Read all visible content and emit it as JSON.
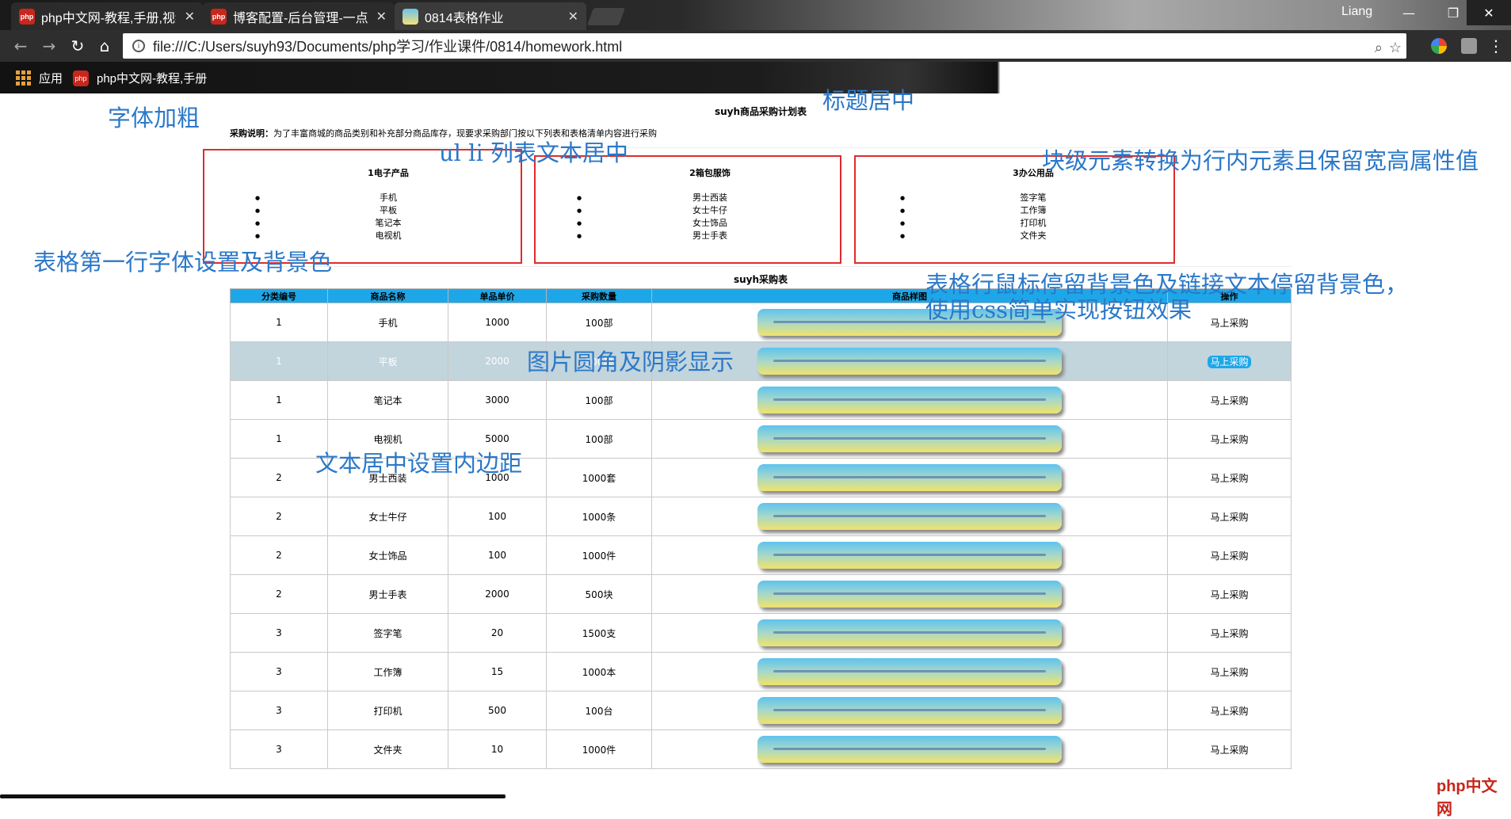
{
  "browser": {
    "tabs": [
      {
        "title": "php中文网-教程,手册,视频"
      },
      {
        "title": "博客配置-后台管理-一点"
      },
      {
        "title": "0814表格作业"
      }
    ],
    "user": "Liang",
    "url": "file:///C:/Users/suyh93/Documents/php学习/作业课件/0814/homework.html",
    "bookmarks": {
      "apps": "应用",
      "php": "php中文网-教程,手册"
    }
  },
  "page": {
    "title": "suyh商品采购计划表",
    "intro_label": "采购说明：",
    "intro_text": "为了丰富商城的商品类别和补充部分商品库存，现要求采购部门按以下列表和表格清单内容进行采购",
    "categories": [
      {
        "name": "1电子产品",
        "items": [
          "手机",
          "平板",
          "笔记本",
          "电视机"
        ]
      },
      {
        "name": "2箱包服饰",
        "items": [
          "男士西装",
          "女士牛仔",
          "女士饰品",
          "男士手表"
        ]
      },
      {
        "name": "3办公用品",
        "items": [
          "签字笔",
          "工作簿",
          "打印机",
          "文件夹"
        ]
      }
    ],
    "table_title": "suyh采购表",
    "columns": [
      "分类编号",
      "商品名称",
      "单品单价",
      "采购数量",
      "商品样图",
      "操作"
    ],
    "rows": [
      {
        "cat": "1",
        "name": "手机",
        "price": "1000",
        "qty": "100部",
        "action": "马上采购"
      },
      {
        "cat": "1",
        "name": "平板",
        "price": "2000",
        "qty": "100部",
        "action": "马上采购"
      },
      {
        "cat": "1",
        "name": "笔记本",
        "price": "3000",
        "qty": "100部",
        "action": "马上采购"
      },
      {
        "cat": "1",
        "name": "电视机",
        "price": "5000",
        "qty": "100部",
        "action": "马上采购"
      },
      {
        "cat": "2",
        "name": "男士西装",
        "price": "1000",
        "qty": "1000套",
        "action": "马上采购"
      },
      {
        "cat": "2",
        "name": "女士牛仔",
        "price": "100",
        "qty": "1000条",
        "action": "马上采购"
      },
      {
        "cat": "2",
        "name": "女士饰品",
        "price": "100",
        "qty": "1000件",
        "action": "马上采购"
      },
      {
        "cat": "2",
        "name": "男士手表",
        "price": "2000",
        "qty": "500块",
        "action": "马上采购"
      },
      {
        "cat": "3",
        "name": "签字笔",
        "price": "20",
        "qty": "1500支",
        "action": "马上采购"
      },
      {
        "cat": "3",
        "name": "工作簿",
        "price": "15",
        "qty": "1000本",
        "action": "马上采购"
      },
      {
        "cat": "3",
        "name": "打印机",
        "price": "500",
        "qty": "100台",
        "action": "马上采购"
      },
      {
        "cat": "3",
        "name": "文件夹",
        "price": "10",
        "qty": "1000件",
        "action": "马上采购"
      }
    ],
    "hover_row": 1
  },
  "annotations": {
    "bold": "字体加粗",
    "center_title": "标题居中",
    "list_center": "ul li 列表文本居中",
    "inline_block": "块级元素转换为行内元素且保留宽高属性值",
    "header_style": "表格第一行字体设置及背景色",
    "hover_line1": "表格行鼠标停留背景色及链接文本停留背景色，",
    "hover_line2": "使用css简单实现按钮效果",
    "image_style": "图片圆角及阴影显示",
    "padding": "文本居中设置内边距"
  },
  "watermark": "php中文网",
  "colors": {
    "header_bg": "#1ea7e8",
    "hover_bg": "#c2d4dc",
    "annotation": "#2b78c8",
    "box": "#e02b2b"
  }
}
